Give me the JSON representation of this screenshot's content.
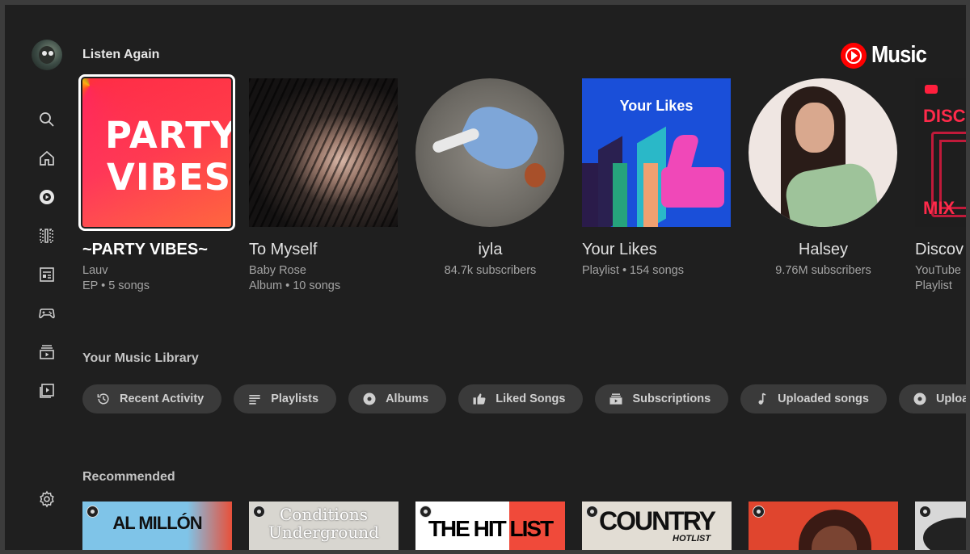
{
  "app": {
    "logo_text": "Music"
  },
  "sidebar": {
    "items": [
      {
        "icon": "search-icon"
      },
      {
        "icon": "home-icon"
      },
      {
        "icon": "music-disc-icon"
      },
      {
        "icon": "library-icon"
      },
      {
        "icon": "news-icon"
      },
      {
        "icon": "gamepad-icon"
      },
      {
        "icon": "subscriptions-icon"
      },
      {
        "icon": "play-box-icon"
      }
    ],
    "settings_icon": "gear-icon"
  },
  "listen_again": {
    "title": "Listen Again",
    "cards": [
      {
        "title": "~PARTY VIBES~",
        "sub1": "Lauv",
        "sub2": "EP • 5 songs",
        "art_text1": "PARTY",
        "art_text2": "VIBES"
      },
      {
        "title": "To Myself",
        "sub1": "Baby Rose",
        "sub2": "Album • 10 songs"
      },
      {
        "title": "iyla",
        "sub1": "84.7k subscribers"
      },
      {
        "title": "Your Likes",
        "sub1": "Playlist • 154 songs",
        "art_text": "Your Likes"
      },
      {
        "title": "Halsey",
        "sub1": "9.76M subscribers"
      },
      {
        "title": "Discov",
        "sub1": "YouTube",
        "sub2": "Playlist",
        "art_text1": "DISCO",
        "art_text2": "MIX"
      }
    ]
  },
  "library": {
    "title": "Your Music Library",
    "chips": [
      {
        "label": "Recent Activity",
        "icon": "history-icon"
      },
      {
        "label": "Playlists",
        "icon": "playlist-icon"
      },
      {
        "label": "Albums",
        "icon": "album-icon"
      },
      {
        "label": "Liked Songs",
        "icon": "thumbs-up-icon"
      },
      {
        "label": "Subscriptions",
        "icon": "subscriptions-icon"
      },
      {
        "label": "Uploaded songs",
        "icon": "music-note-icon"
      },
      {
        "label": "Uploaded",
        "icon": "album-icon"
      }
    ]
  },
  "recommended": {
    "title": "Recommended",
    "tiles": [
      {
        "text": "AL MILLÓN"
      },
      {
        "text1": "Conditions",
        "text2": "Underground"
      },
      {
        "text": "THE HIT LIST"
      },
      {
        "text1": "COUNTRY",
        "text2": "HOTLIST"
      },
      {
        "text": ""
      },
      {
        "text": ""
      }
    ]
  },
  "colors": {
    "background": "#1f1f1f",
    "accent": "#ff0000",
    "chip": "#3a3a3a"
  }
}
